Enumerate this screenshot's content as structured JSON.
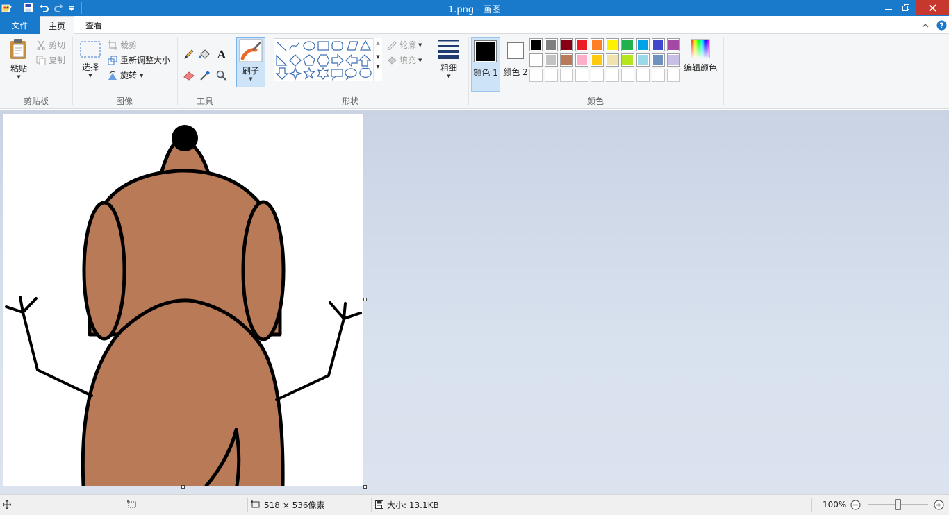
{
  "window": {
    "title": "1.png - 画图"
  },
  "tabs": {
    "file": "文件",
    "home": "主页",
    "view": "查看"
  },
  "ribbon": {
    "clipboard": {
      "paste": "粘贴",
      "cut": "剪切",
      "copy": "复制",
      "label": "剪贴板"
    },
    "image": {
      "select": "选择",
      "crop": "裁剪",
      "resize": "重新调整大小",
      "rotate": "旋转",
      "label": "图像"
    },
    "tools": {
      "label": "工具"
    },
    "brushes": {
      "label": "刷子"
    },
    "shapes": {
      "outline": "轮廓",
      "fill": "填充",
      "label": "形状"
    },
    "size": {
      "label": "粗细"
    },
    "colors": {
      "color1": "颜色 1",
      "color2": "颜色 2",
      "edit": "编辑颜色",
      "label": "颜色",
      "palette_row1": [
        "#000000",
        "#7f7f7f",
        "#880015",
        "#ed1c24",
        "#ff7f27",
        "#fff200",
        "#22b14c",
        "#00a2e8",
        "#3f48cc",
        "#a349a4"
      ],
      "palette_row2": [
        "#ffffff",
        "#c3c3c3",
        "#b97a57",
        "#ffaec9",
        "#ffc90e",
        "#efe4b0",
        "#b5e61d",
        "#99d9ea",
        "#7092be",
        "#c8bfe7"
      ],
      "palette_row3": [
        "#ffffff",
        "#ffffff",
        "#ffffff",
        "#ffffff",
        "#ffffff",
        "#ffffff",
        "#ffffff",
        "#ffffff",
        "#ffffff",
        "#ffffff"
      ]
    }
  },
  "status": {
    "dimensions": "518 × 536像素",
    "filesize": "大小: 13.1KB",
    "zoom": "100%"
  }
}
